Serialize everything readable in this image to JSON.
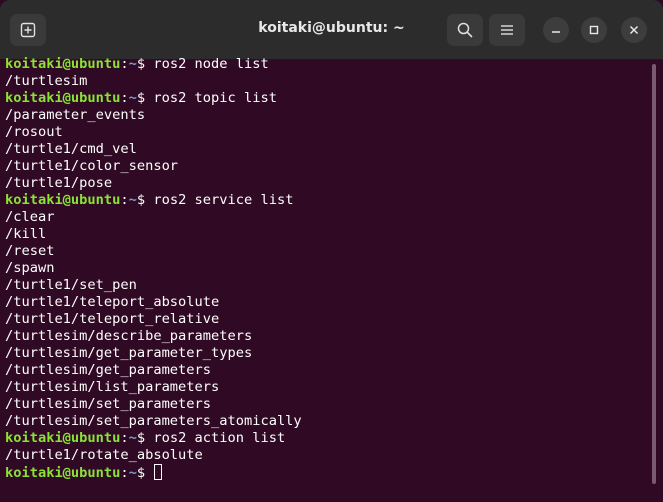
{
  "window": {
    "title": "koitaki@ubuntu: ~"
  },
  "icons": {
    "new_tab": "new-tab-icon",
    "search": "search-icon",
    "menu": "hamburger-menu-icon",
    "minimize": "minimize-icon",
    "maximize": "maximize-icon",
    "close": "close-icon"
  },
  "colors": {
    "terminal_bg": "#300a24",
    "prompt_user": "#8ae234",
    "prompt_path": "#729fcf",
    "text": "#ffffff"
  },
  "prompt": {
    "user": "koitaki@ubuntu",
    "colon": ":",
    "path": "~",
    "symbol": "$ "
  },
  "terminal": {
    "lines": [
      {
        "type": "cmd",
        "text": "ros2 node list"
      },
      {
        "type": "out",
        "text": "/turtlesim"
      },
      {
        "type": "cmd",
        "text": "ros2 topic list"
      },
      {
        "type": "out",
        "text": "/parameter_events"
      },
      {
        "type": "out",
        "text": "/rosout"
      },
      {
        "type": "out",
        "text": "/turtle1/cmd_vel"
      },
      {
        "type": "out",
        "text": "/turtle1/color_sensor"
      },
      {
        "type": "out",
        "text": "/turtle1/pose"
      },
      {
        "type": "cmd",
        "text": "ros2 service list"
      },
      {
        "type": "out",
        "text": "/clear"
      },
      {
        "type": "out",
        "text": "/kill"
      },
      {
        "type": "out",
        "text": "/reset"
      },
      {
        "type": "out",
        "text": "/spawn"
      },
      {
        "type": "out",
        "text": "/turtle1/set_pen"
      },
      {
        "type": "out",
        "text": "/turtle1/teleport_absolute"
      },
      {
        "type": "out",
        "text": "/turtle1/teleport_relative"
      },
      {
        "type": "out",
        "text": "/turtlesim/describe_parameters"
      },
      {
        "type": "out",
        "text": "/turtlesim/get_parameter_types"
      },
      {
        "type": "out",
        "text": "/turtlesim/get_parameters"
      },
      {
        "type": "out",
        "text": "/turtlesim/list_parameters"
      },
      {
        "type": "out",
        "text": "/turtlesim/set_parameters"
      },
      {
        "type": "out",
        "text": "/turtlesim/set_parameters_atomically"
      },
      {
        "type": "cmd",
        "text": "ros2 action list"
      },
      {
        "type": "out",
        "text": "/turtle1/rotate_absolute"
      },
      {
        "type": "cmd",
        "text": "",
        "cursor": true
      }
    ]
  }
}
